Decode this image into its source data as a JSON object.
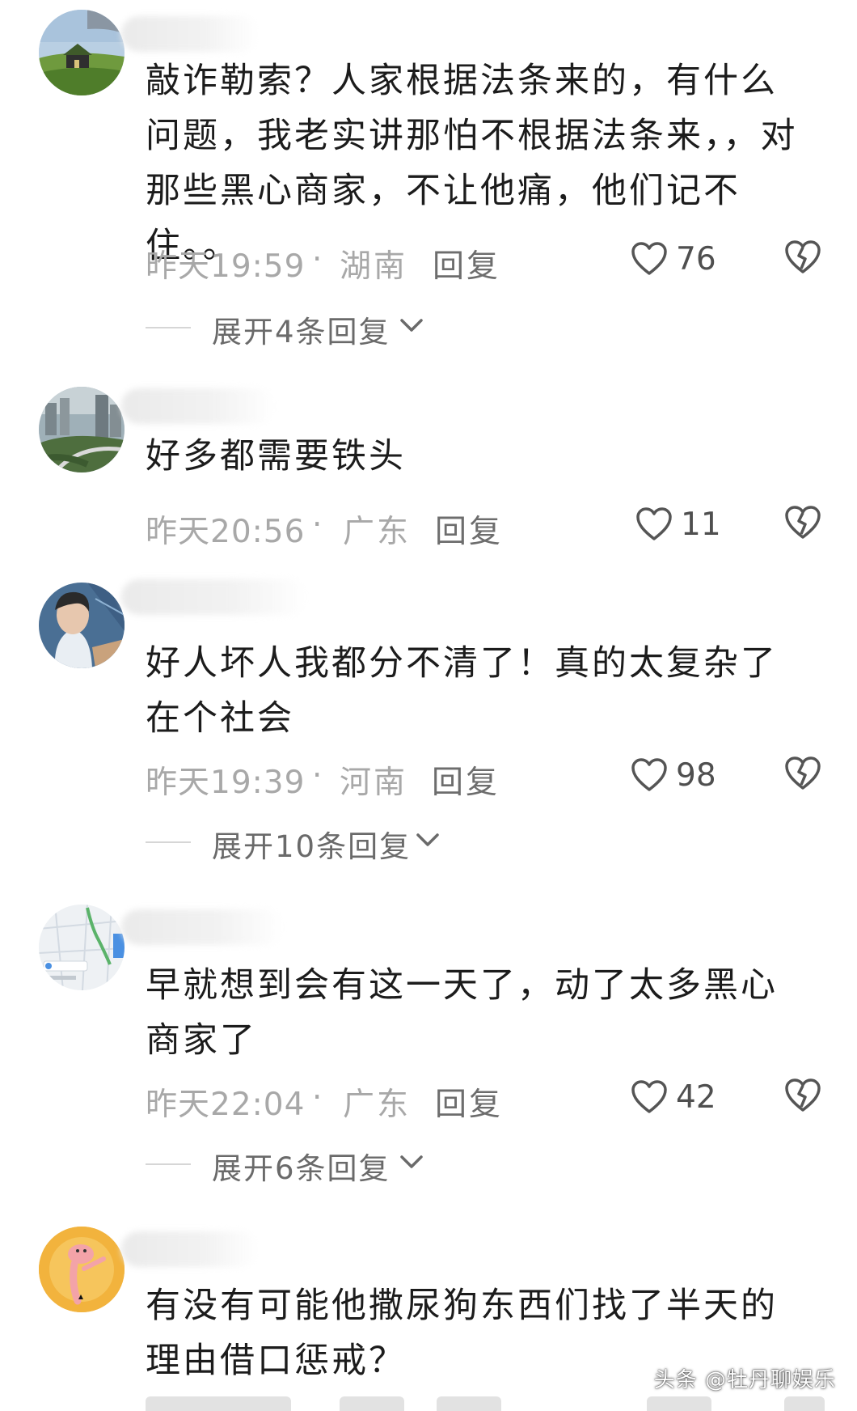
{
  "colors": {
    "text": "#1c1c1c",
    "meta": "#a8a8a8",
    "reply": "#6d6d6d",
    "icon": "#555555"
  },
  "comments": [
    {
      "avatar_icon": "house-landscape-avatar",
      "text": "敲诈勒索？人家根据法条来的，有什么问题，我老实讲那怕不根据法条来，，对那些黑心商家，不让他痛，他们记不住。。",
      "time": "昨天19:59",
      "dot": "·",
      "location": "湖南",
      "reply_label": "回复",
      "likes": "76",
      "expand_label": "展开4条回复"
    },
    {
      "avatar_icon": "city-view-avatar",
      "text": "好多都需要铁头",
      "time": "昨天20:56",
      "dot": "·",
      "location": "广东",
      "reply_label": "回复",
      "likes": "11",
      "expand_label": ""
    },
    {
      "avatar_icon": "person-photo-avatar",
      "text": "好人坏人我都分不清了！真的太复杂了在个社会",
      "time": "昨天19:39",
      "dot": "·",
      "location": "河南",
      "reply_label": "回复",
      "likes": "98",
      "expand_label": "展开10条回复"
    },
    {
      "avatar_icon": "map-screenshot-avatar",
      "text": "早就想到会有这一天了，动了太多黑心商家了",
      "time": "昨天22:04",
      "dot": "·",
      "location": "广东",
      "reply_label": "回复",
      "likes": "42",
      "expand_label": "展开6条回复"
    },
    {
      "avatar_icon": "cartoon-panther-avatar",
      "text": "有没有可能他撒尿狗东西们找了半天的理由借口惩戒？",
      "time": "",
      "dot": "",
      "location": "",
      "reply_label": "",
      "likes": "",
      "expand_label": ""
    }
  ],
  "watermark": "头条 @牡丹聊娱乐"
}
